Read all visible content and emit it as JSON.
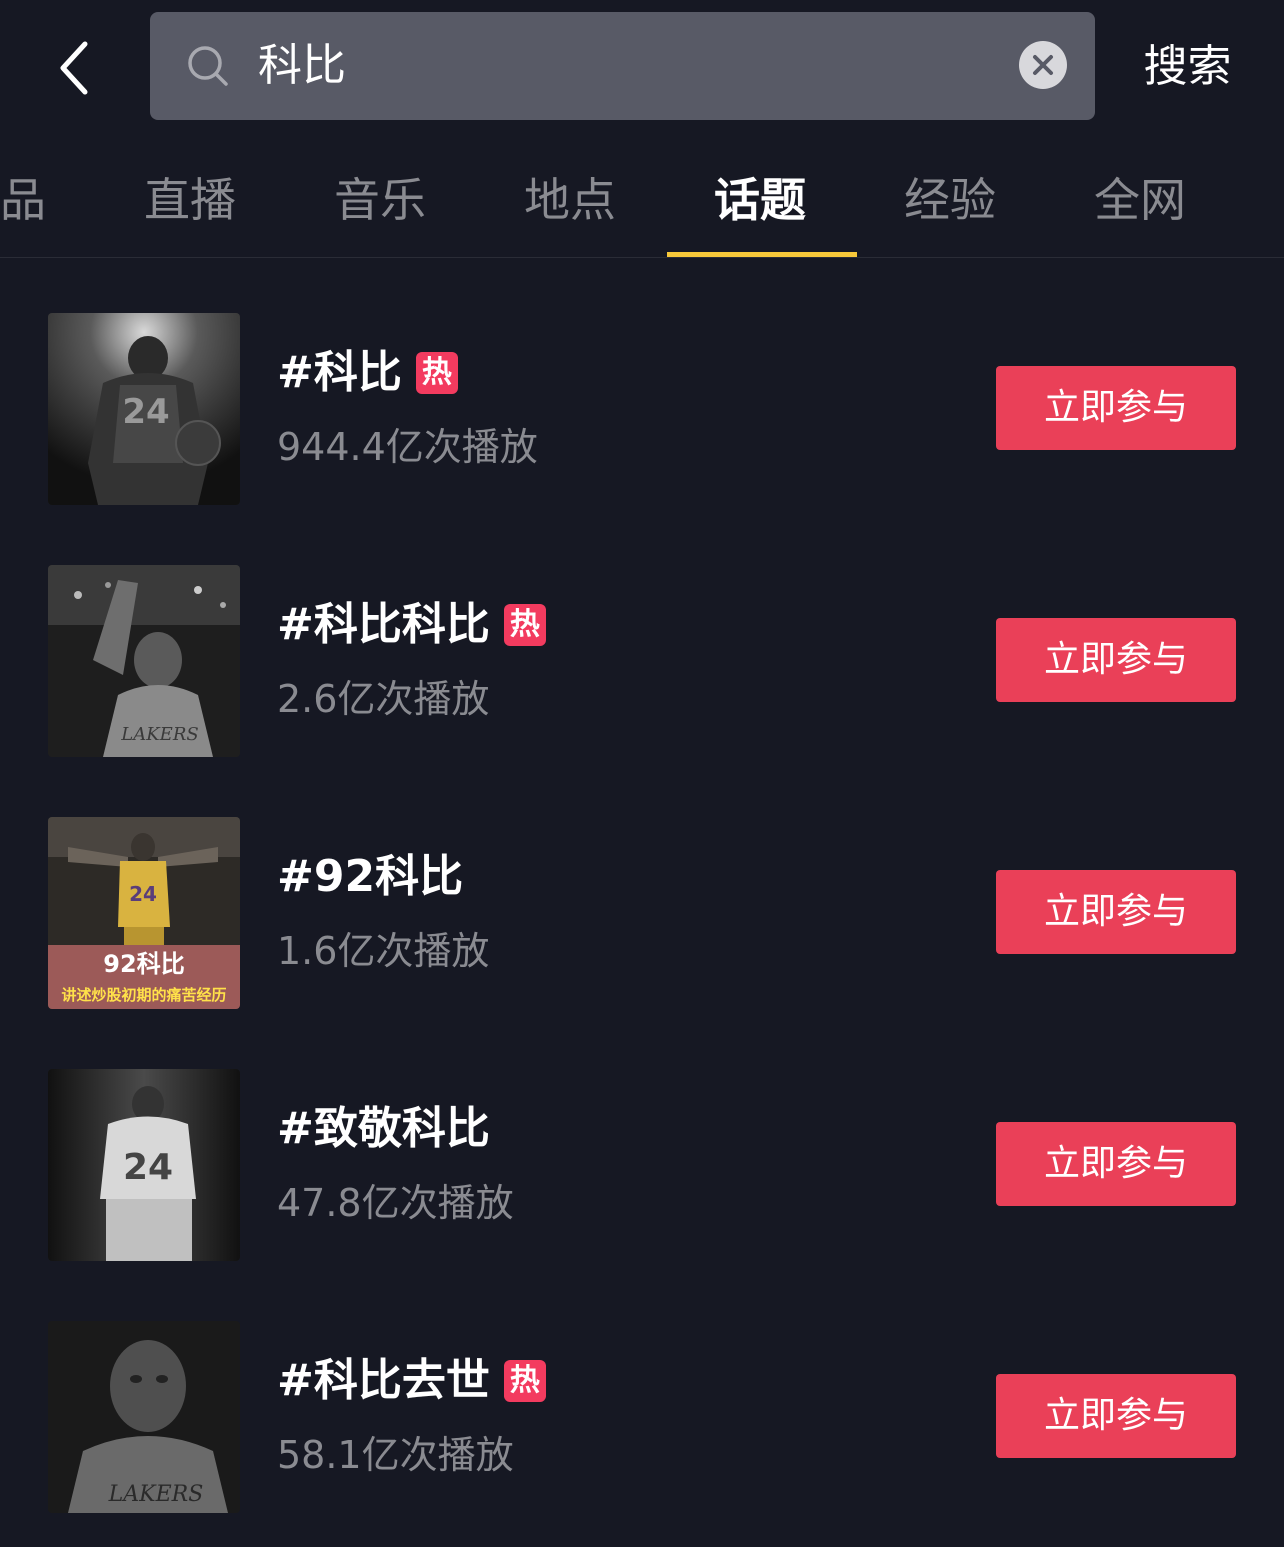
{
  "search": {
    "query": "科比",
    "submit_label": "搜索"
  },
  "tabs": [
    {
      "label": "品",
      "active": false
    },
    {
      "label": "直播",
      "active": false
    },
    {
      "label": "音乐",
      "active": false
    },
    {
      "label": "地点",
      "active": false
    },
    {
      "label": "话题",
      "active": true
    },
    {
      "label": "经验",
      "active": false
    },
    {
      "label": "全网",
      "active": false
    }
  ],
  "colors": {
    "background": "#161823",
    "accent_underline": "#f7c83a",
    "join_button": "#ea4058",
    "hot_badge": "#f33b5f",
    "secondary_text": "#8a8b91"
  },
  "topics": [
    {
      "title": "#科比",
      "hot_label": "热",
      "views": "944.4亿次播放",
      "join_label": "立即参与",
      "thumbnail": "photo-kobe-back-spotlight"
    },
    {
      "title": "#科比科比",
      "hot_label": "热",
      "views": "2.6亿次播放",
      "join_label": "立即参与",
      "thumbnail": "photo-kobe-waving"
    },
    {
      "title": "#92科比",
      "views": "1.6亿次播放",
      "join_label": "立即参与",
      "thumbnail": "photo-kobe-yellow-jersey",
      "thumb_caption": "92科比",
      "thumb_subcaption": "讲述炒股初期的痛苦经历"
    },
    {
      "title": "#致敬科比",
      "views": "47.8亿次播放",
      "join_label": "立即参与",
      "thumbnail": "photo-kobe-walking-away"
    },
    {
      "title": "#科比去世",
      "hot_label": "热",
      "views": "58.1亿次播放",
      "join_label": "立即参与",
      "thumbnail": "photo-kobe-portrait"
    }
  ]
}
